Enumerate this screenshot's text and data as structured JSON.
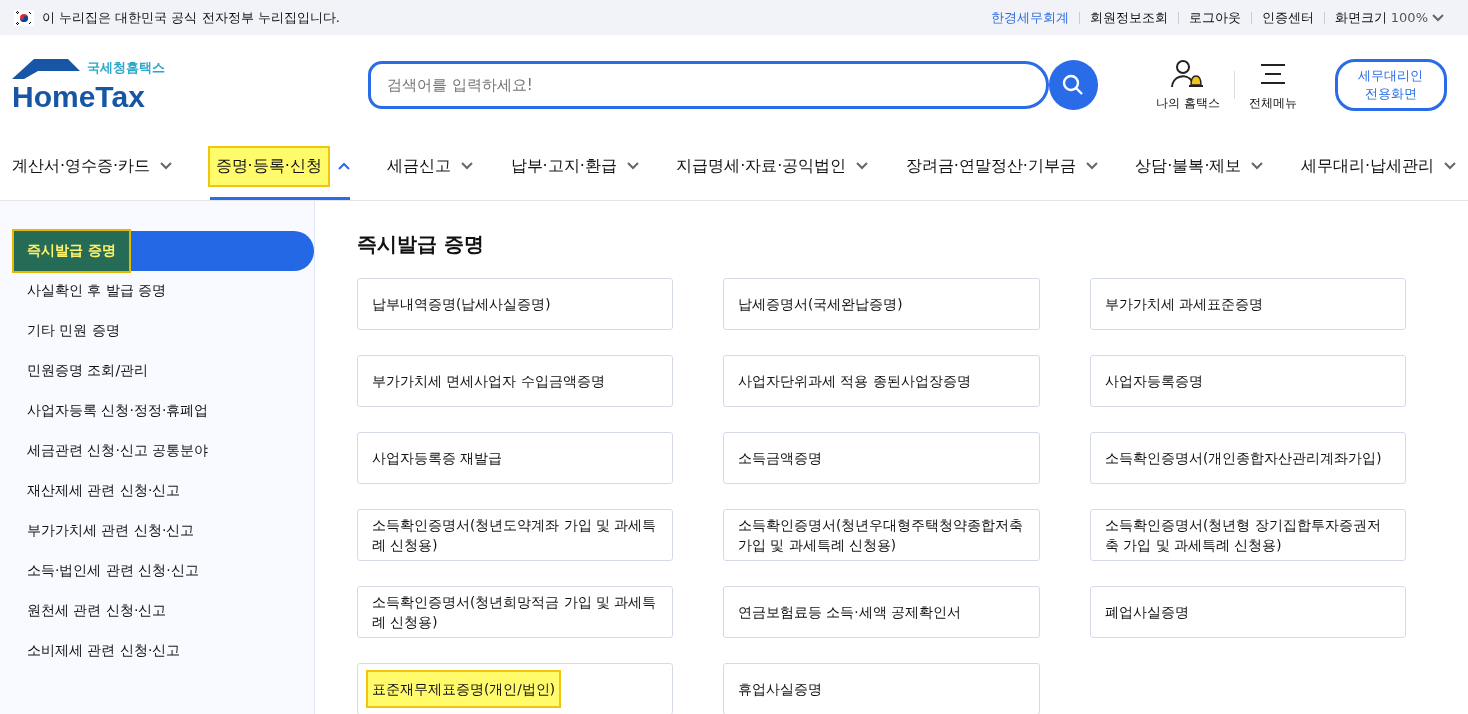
{
  "gov_banner": {
    "text": "이 누리집은 대한민국 공식 전자정부 누리집입니다."
  },
  "utility_links": [
    {
      "label": "한경세무회계",
      "kind": "accent"
    },
    {
      "label": "회원정보조회",
      "kind": "plain"
    },
    {
      "label": "로그아웃",
      "kind": "plain"
    },
    {
      "label": "인증센터",
      "kind": "plain"
    },
    {
      "label": "화면크기",
      "kind": "zoom",
      "value": "100%"
    }
  ],
  "logo": {
    "subtitle": "국세청홈택스",
    "title": "HomeTax"
  },
  "search": {
    "placeholder": "검색어를 입력하세요!"
  },
  "header_actions": [
    {
      "label": "나의 홈택스",
      "kind": "my"
    },
    {
      "label": "전체메뉴",
      "kind": "menu"
    }
  ],
  "agent_button": {
    "line1": "세무대리인",
    "line2": "전용화면"
  },
  "nav": [
    {
      "label": "계산서·영수증·카드",
      "selected": false,
      "highlighted": false
    },
    {
      "label": "증명·등록·신청",
      "selected": true,
      "highlighted": true
    },
    {
      "label": "세금신고",
      "selected": false,
      "highlighted": false
    },
    {
      "label": "납부·고지·환급",
      "selected": false,
      "highlighted": false
    },
    {
      "label": "지급명세·자료·공익법인",
      "selected": false,
      "highlighted": false
    },
    {
      "label": "장려금·연말정산·기부금",
      "selected": false,
      "highlighted": false
    },
    {
      "label": "상담·불복·제보",
      "selected": false,
      "highlighted": false
    },
    {
      "label": "세무대리·납세관리",
      "selected": false,
      "highlighted": false
    }
  ],
  "sidebar": {
    "items": [
      {
        "label": "즉시발급 증명",
        "selected": true,
        "highlighted": true
      },
      {
        "label": "사실확인 후 발급 증명",
        "selected": false,
        "highlighted": false
      },
      {
        "label": "기타 민원 증명",
        "selected": false,
        "highlighted": false
      },
      {
        "label": "민원증명 조회/관리",
        "selected": false,
        "highlighted": false
      },
      {
        "label": "사업자등록 신청·정정·휴폐업",
        "selected": false,
        "highlighted": false
      },
      {
        "label": "세금관련 신청·신고 공통분야",
        "selected": false,
        "highlighted": false
      },
      {
        "label": "재산제세 관련 신청·신고",
        "selected": false,
        "highlighted": false
      },
      {
        "label": "부가가치세 관련 신청·신고",
        "selected": false,
        "highlighted": false
      },
      {
        "label": "소득·법인세 관련 신청·신고",
        "selected": false,
        "highlighted": false
      },
      {
        "label": "원천세 관련 신청·신고",
        "selected": false,
        "highlighted": false
      },
      {
        "label": "소비제세 관련 신청·신고",
        "selected": false,
        "highlighted": false
      }
    ]
  },
  "content": {
    "title": "즉시발급 증명",
    "cards": [
      {
        "label": "납부내역증명(납세사실증명)",
        "highlighted": false
      },
      {
        "label": "납세증명서(국세완납증명)",
        "highlighted": false
      },
      {
        "label": "부가가치세 과세표준증명",
        "highlighted": false
      },
      {
        "label": "부가가치세 면세사업자 수입금액증명",
        "highlighted": false
      },
      {
        "label": "사업자단위과세 적용 종된사업장증명",
        "highlighted": false
      },
      {
        "label": "사업자등록증명",
        "highlighted": false
      },
      {
        "label": "사업자등록증 재발급",
        "highlighted": false
      },
      {
        "label": "소득금액증명",
        "highlighted": false
      },
      {
        "label": "소득확인증명서(개인종합자산관리계좌가입)",
        "highlighted": false
      },
      {
        "label": "소득확인증명서(청년도약계좌 가입 및 과세특례 신청용)",
        "highlighted": false
      },
      {
        "label": "소득확인증명서(청년우대형주택청약종합저축 가입 및 과세특례 신청용)",
        "highlighted": false
      },
      {
        "label": "소득확인증명서(청년형 장기집합투자증권저축 가입 및 과세특례 신청용)",
        "highlighted": false
      },
      {
        "label": "소득확인증명서(청년희망적금 가입 및 과세특례 신청용)",
        "highlighted": false
      },
      {
        "label": "연금보험료등 소득·세액 공제확인서",
        "highlighted": false
      },
      {
        "label": "폐업사실증명",
        "highlighted": false
      },
      {
        "label": "표준재무제표증명(개인/법인)",
        "highlighted": true
      },
      {
        "label": "휴업사실증명",
        "highlighted": false
      }
    ]
  }
}
